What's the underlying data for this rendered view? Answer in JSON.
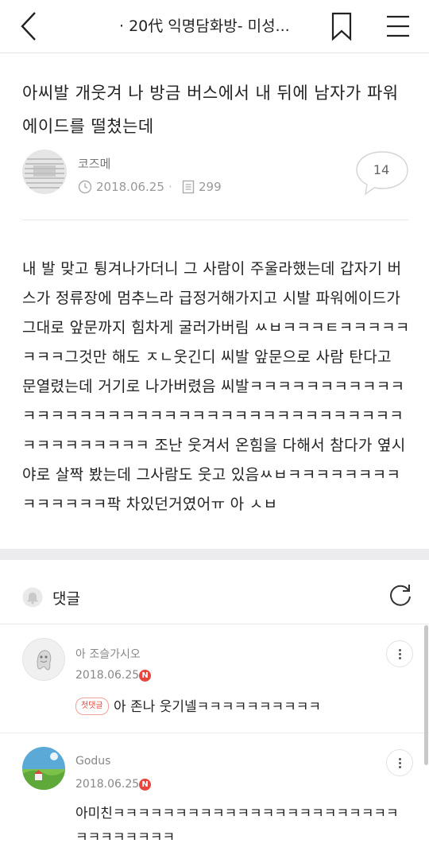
{
  "header": {
    "title": "· 20代 익명담화방- 미성..."
  },
  "post": {
    "title": "아씨발 개웃겨 나 방금 버스에서 내 뒤에 남자가 파워에이드를 떨쳤는데",
    "author": "코즈메",
    "date": "2018.06.25",
    "separator": "·",
    "views": "299",
    "comment_count": "14",
    "body": "내 발 맞고 튕겨나가더니 그 사람이 주울라했는데 갑자기 버스가 정류장에 멈추느라 급정거해가지고 시발 파워에이드가 그대로 앞문까지 힘차게 굴러가버림 ㅆㅂㅋㅋㅋㅌㅋㅋㅋㅋㅋㅋㅋㅋ그것만 해도 ㅈㄴ웃긴디 씨발 앞문으로 사람 탄다고 문열렸는데 거기로 나가버렸음 씨발ㅋㅋㅋㅋㅋㅋㅋㅋㅋㅋㅋㅋㅋㅋㅋㅋㅋㅋㅋㅋㅋㅋㅋㅋㅋㅋㅋㅋㅋㅋㅋㅋㅋㅋㅋㅋㅋㅋㅋㅋㅋㅋㅋㅋㅋㅋㅋ 조난 웃겨서 온힘을 다해서 참다가 옆시야로 살짝 봤는데 그사람도 웃고 있음ㅆㅂㅋㅋㅋㅋㅋㅋㅋㅋㅋㅋㅋㅋㅋㅋ팍 차있던거였어ㅠ 아 ㅅㅂ"
  },
  "comments_section": {
    "label": "댓글"
  },
  "comments": [
    {
      "author": "아 조슬가시오",
      "date": "2018.06.25",
      "badge": "N",
      "first_badge": "첫댓글",
      "text": "아 존나 웃기넬ㅋㅋㅋㅋㅋㅋㅋㅋㅋㅋ"
    },
    {
      "author": "Godus",
      "date": "2018.06.25",
      "badge": "N",
      "text": "아미친ㅋㅋㅋㅋㅋㅋㅋㅋㅋㅋㅋㅋㅋㅋㅋㅋㅋㅋㅋㅋㅋㅋㅋㅋㅋㅋㅋㅋㅋㅋㅋ"
    }
  ],
  "icons": {
    "back": "chevron-left-icon",
    "bookmark": "bookmark-icon",
    "menu": "hamburger-menu-icon",
    "clock": "clock-icon",
    "views": "document-icon",
    "bell": "bell-icon",
    "refresh": "refresh-icon",
    "more": "more-vertical-icon"
  },
  "colors": {
    "new_badge": "#e8453c",
    "text": "#222222",
    "muted": "#999999",
    "section_gap": "#ececef"
  }
}
